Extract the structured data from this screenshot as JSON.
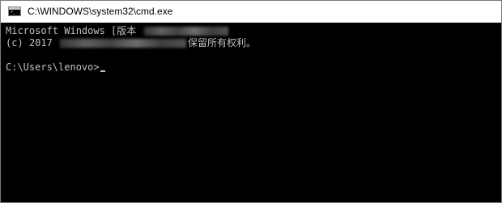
{
  "window": {
    "title": "C:\\WINDOWS\\system32\\cmd.exe",
    "icon": "cmd-icon"
  },
  "console": {
    "line1_prefix": "Microsoft Windows [版本",
    "line2_prefix": "(c) 2017",
    "line2_suffix": "保留所有权利。",
    "prompt": "C:\\Users\\lenovo>"
  }
}
